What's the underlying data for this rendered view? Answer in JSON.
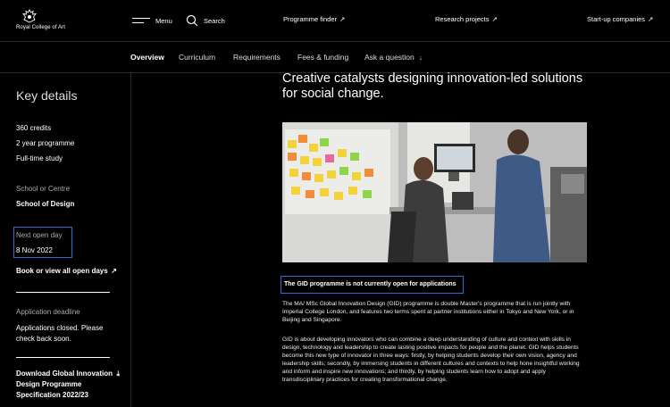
{
  "header": {
    "logo_text": "Royal College of Art",
    "menu_label": "Menu",
    "search_label": "Search",
    "links": [
      {
        "label": "Programme finder",
        "arrow": "↗"
      },
      {
        "label": "Research projects",
        "arrow": "↗"
      },
      {
        "label": "Start-up companies",
        "arrow": "↗"
      }
    ]
  },
  "subnav": {
    "items": [
      "Overview",
      "Curriculum",
      "Requirements",
      "Fees & funding",
      "Ask a question"
    ],
    "ask_arrow": "↓",
    "active": "Overview"
  },
  "sidebar": {
    "heading": "Key details",
    "credits": "360 credits",
    "duration": "2 year programme",
    "mode": "Full-time study",
    "school_label": "School or Centre",
    "school_value": "School of Design",
    "open_day_label": "Next open day",
    "open_day_value": "8 Nov 2022",
    "book_link": "Book or view all open days",
    "book_arrow": "↗",
    "deadline_label": "Application deadline",
    "deadline_value": "Applications closed. Please check back soon.",
    "download_link": "Download Global Innovation Design Programme Specification 2022/23",
    "download_arrow": "⤓"
  },
  "main": {
    "title": "Creative catalysts designing innovation-led solutions for social change.",
    "notice": "The GID programme is not currently open for applications",
    "para1": "The MA/ MSc Global Innovation Design (GID) programme is double Master's programme that is run jointly with Imperial College London, and features two terms spent at partner institutions either in Tokyo and New York, or in Beijing and Singapore.",
    "para2": "GID is about developing innovators who can combine a deep understanding of culture and context with skills in design, technology and leadership to create lasting positive impacts for people and the planet. GID helps students become this new type of innovator in three ways: firstly, by helping students develop their own vision, agency and leadership skills; secondly, by immersing students in different cultures and contexts to help hone insightful working and inform and inspire new innovations; and thirdly, by helping students learn how to adopt and apply transdisciplinary practices for creating transformational change."
  },
  "colors": {
    "background": "#000000",
    "focus_outline": "#2d6fd6",
    "text": "#ffffff"
  }
}
